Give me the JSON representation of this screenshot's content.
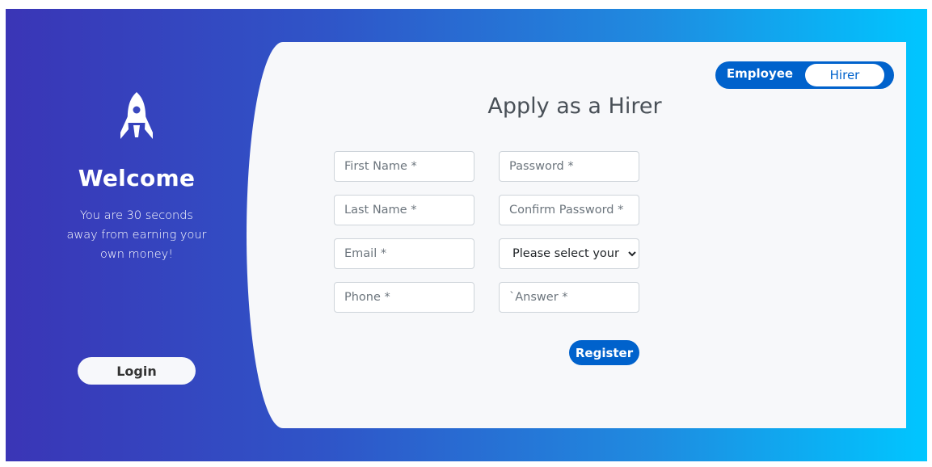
{
  "left_panel": {
    "icon": "rocket-icon",
    "welcome": "Welcome",
    "tagline": "You are 30 seconds away from earning your own money!",
    "login_label": "Login"
  },
  "toggle": {
    "employee_label": "Employee",
    "hirer_label": "Hirer"
  },
  "form": {
    "heading": "Apply as a Hirer",
    "first_name_placeholder": "First Name *",
    "last_name_placeholder": "Last Name *",
    "email_placeholder": "Email *",
    "phone_placeholder": "Phone *",
    "password_placeholder": "Password *",
    "confirm_password_placeholder": "Confirm Password *",
    "security_question_selected": "Please select your",
    "answer_placeholder": "`Answer *",
    "register_label": "Register"
  },
  "colors": {
    "gradient_start": "#3a35b6",
    "gradient_end": "#00c6ff",
    "accent": "#0062cc",
    "card_bg": "#f7f8fa"
  }
}
